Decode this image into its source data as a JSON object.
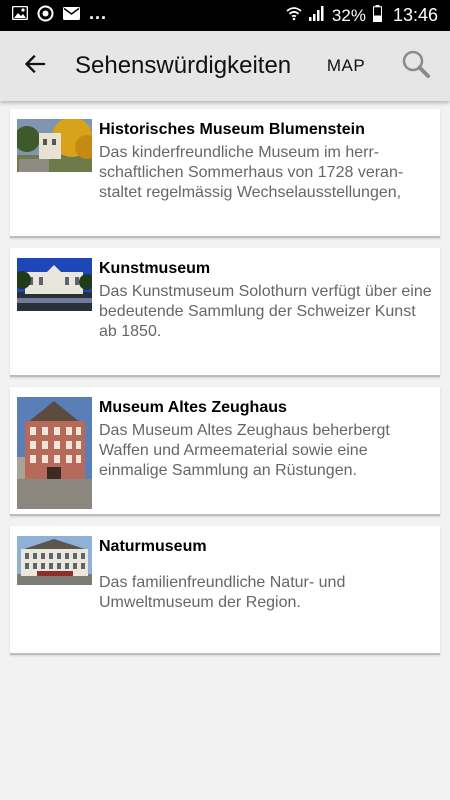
{
  "status_bar": {
    "battery": "32%",
    "time": "13:46",
    "dots": "...",
    "icons": [
      "image-icon",
      "sync-icon",
      "mail-icon",
      "wifi-icon",
      "signal-icon",
      "battery-icon"
    ]
  },
  "app_bar": {
    "title": "Sehenswürdigkeiten",
    "map_label": "MAP",
    "back_icon": "arrow-back-icon",
    "search_icon": "search-icon"
  },
  "items": [
    {
      "title": "Historisches Museum Blumenstein",
      "description": "Das kinderfreundliche Museum im herr-schaftlichen Sommerhaus von 1728 veran-staltet regelmässig Wechselausstellungen,"
    },
    {
      "title": "Kunstmuseum",
      "description": "Das Kunstmuseum Solothurn verfügt über eine bedeutende Sammlung der Schweizer Kunst ab 1850."
    },
    {
      "title": "Museum Altes Zeughaus",
      "description": "Das Museum Altes Zeughaus beherbergt Waffen und Armeematerial sowie eine einmalige Sammlung an Rüstungen."
    },
    {
      "title": "Naturmuseum",
      "description": "Das familienfreundliche Natur- und Umweltmuseum der Region."
    }
  ],
  "colors": {
    "status_bar_bg": "#000000",
    "app_bar_bg": "#e6e6e6",
    "page_bg": "#f2f2f2",
    "card_bg": "#ffffff",
    "description_text": "#666666"
  }
}
